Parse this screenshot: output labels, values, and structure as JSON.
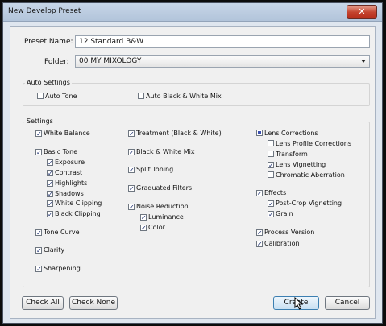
{
  "window": {
    "title": "New Develop Preset",
    "close_glyph": "✕"
  },
  "preset_name": {
    "label": "Preset Name:",
    "value": "12 Standard B&W"
  },
  "folder": {
    "label": "Folder:",
    "value": "00 MY MIXOLOGY"
  },
  "auto_settings": {
    "title": "Auto Settings",
    "auto_tone": {
      "label": "Auto Tone",
      "checked": false
    },
    "auto_bw_mix": {
      "label": "Auto Black & White Mix",
      "checked": false
    }
  },
  "settings": {
    "title": "Settings",
    "col1": {
      "white_balance": {
        "label": "White Balance",
        "checked": true
      },
      "basic_tone": {
        "label": "Basic Tone",
        "checked": true
      },
      "exposure": {
        "label": "Exposure",
        "checked": true
      },
      "contrast": {
        "label": "Contrast",
        "checked": true
      },
      "highlights": {
        "label": "Highlights",
        "checked": true
      },
      "shadows": {
        "label": "Shadows",
        "checked": true
      },
      "white_clipping": {
        "label": "White Clipping",
        "checked": true
      },
      "black_clipping": {
        "label": "Black Clipping",
        "checked": true
      },
      "tone_curve": {
        "label": "Tone Curve",
        "checked": true
      },
      "clarity": {
        "label": "Clarity",
        "checked": true
      },
      "sharpening": {
        "label": "Sharpening",
        "checked": true
      }
    },
    "col2": {
      "treatment": {
        "label": "Treatment (Black & White)",
        "checked": true
      },
      "bw_mix": {
        "label": "Black & White Mix",
        "checked": true
      },
      "split_toning": {
        "label": "Split Toning",
        "checked": true
      },
      "graduated_filters": {
        "label": "Graduated Filters",
        "checked": true
      },
      "noise_reduction": {
        "label": "Noise Reduction",
        "checked": true
      },
      "luminance": {
        "label": "Luminance",
        "checked": true
      },
      "color": {
        "label": "Color",
        "checked": true
      }
    },
    "col3": {
      "lens_corrections": {
        "label": "Lens Corrections",
        "checked": "partial"
      },
      "lens_profile": {
        "label": "Lens Profile Corrections",
        "checked": false
      },
      "transform": {
        "label": "Transform",
        "checked": false
      },
      "lens_vignetting": {
        "label": "Lens Vignetting",
        "checked": true
      },
      "chromatic_aberration": {
        "label": "Chromatic Aberration",
        "checked": false
      },
      "effects": {
        "label": "Effects",
        "checked": true
      },
      "post_crop_vignetting": {
        "label": "Post-Crop Vignetting",
        "checked": true
      },
      "grain": {
        "label": "Grain",
        "checked": true
      },
      "process_version": {
        "label": "Process Version",
        "checked": true
      },
      "calibration": {
        "label": "Calibration",
        "checked": true
      }
    }
  },
  "buttons": {
    "check_all": "Check All",
    "check_none": "Check None",
    "create": "Create",
    "cancel": "Cancel"
  },
  "check_glyph": "✓"
}
